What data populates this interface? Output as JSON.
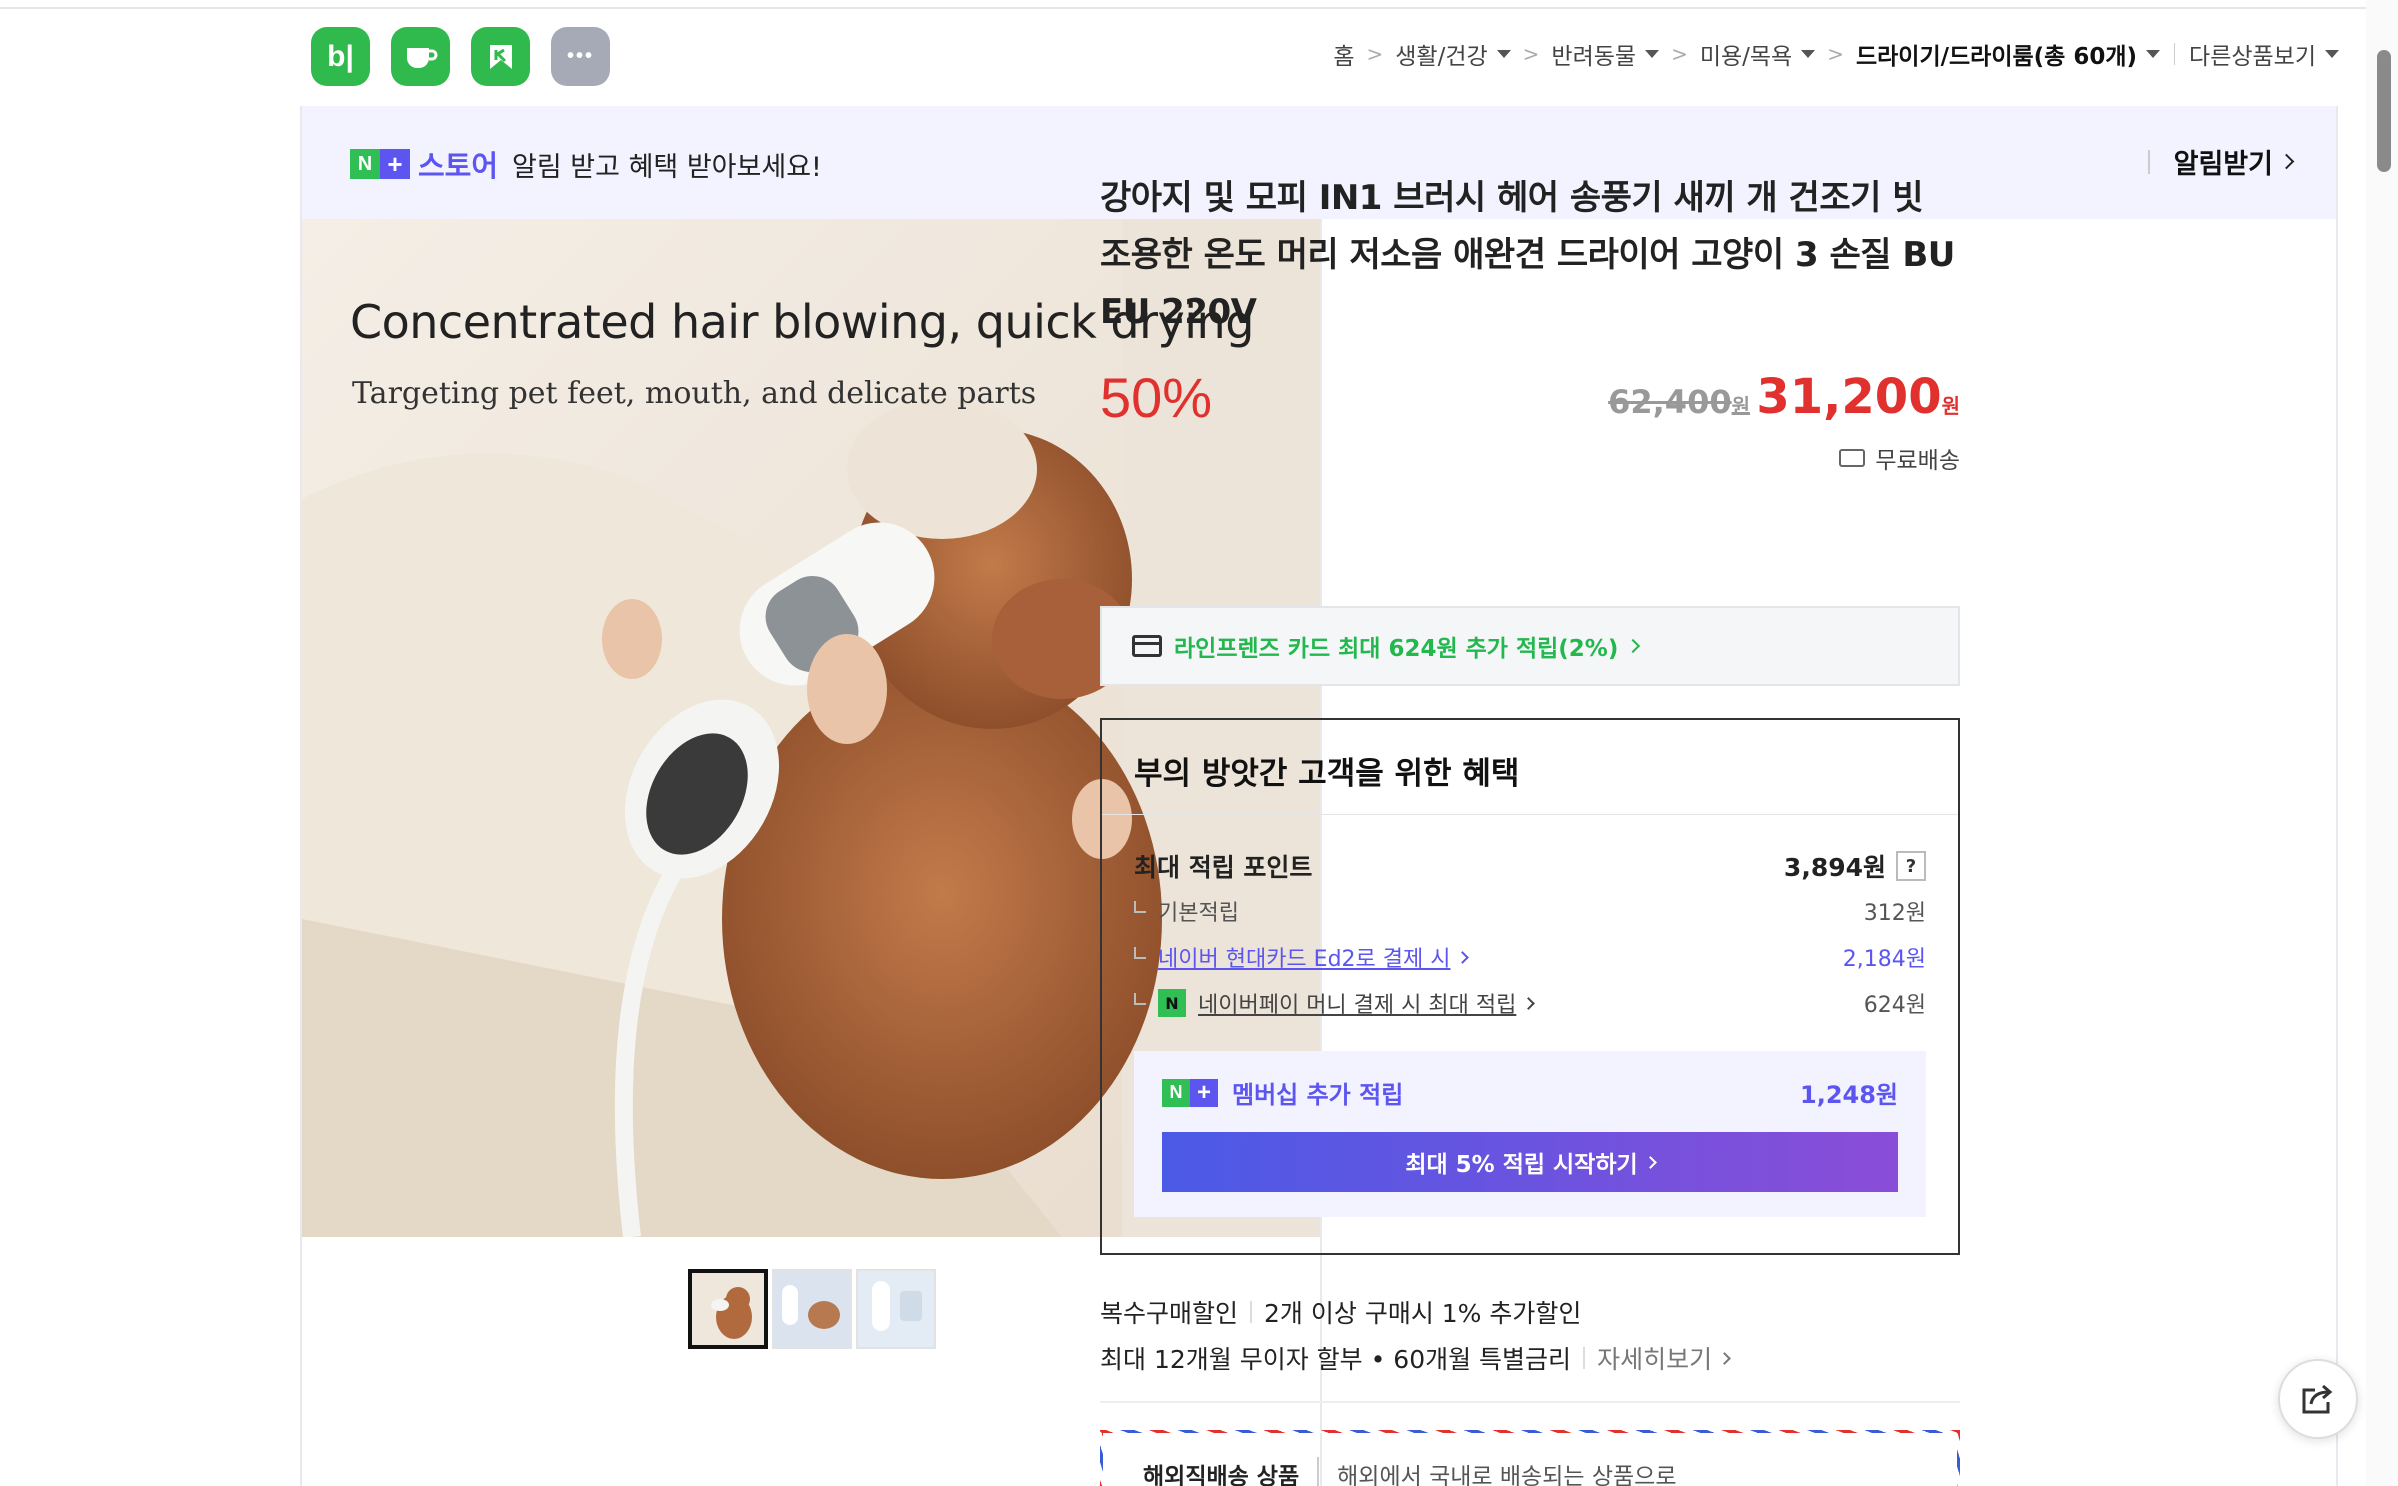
{
  "app_icons": [
    {
      "name": "blog-icon",
      "glyph": "b|",
      "color": "#30b94c"
    },
    {
      "name": "cafe-icon",
      "glyph": "☕",
      "color": "#30b94c"
    },
    {
      "name": "kin-icon",
      "glyph": "K",
      "color": "#30b94c"
    },
    {
      "name": "more-icon",
      "glyph": "•••",
      "color": "#a5aab6"
    }
  ],
  "breadcrumb": {
    "home": "홈",
    "cat1": "생활/건강",
    "cat2": "반려동물",
    "cat3": "미용/목욕",
    "cat4": "드라이기/드라이룸(총 60개)",
    "other": "다른상품보기"
  },
  "banner": {
    "store": "스토어",
    "message": "알림 받고 혜택 받아보세요!",
    "action": "알림받기"
  },
  "product_image": {
    "headline": "Concentrated hair blowing, quick drying",
    "subline": "Targeting pet feet, mouth, and delicate parts"
  },
  "product": {
    "title": "강아지 및 모피 IN1 브러시 헤어 송풍기 새끼 개 건조기 빗 조용한 온도 머리 저소음 애완견 드라이어 고양이 3 손질 BU EU 220V",
    "discount": "50%",
    "original_price": "62,400",
    "sale_price": "31,200",
    "currency": "원",
    "shipping": "무료배송"
  },
  "card_promo": "라인프렌즈 카드 최대 624원 추가 적립(2%)",
  "benefits": {
    "title": "부의 방앗간 고객을 위한 혜택",
    "max_points_label": "최대 적립 포인트",
    "max_points_value": "3,894원",
    "help": "?",
    "basic_label": "기본적립",
    "basic_value": "312원",
    "card_label": "네이버 현대카드 Ed2로 결제 시",
    "card_value": "2,184원",
    "npay_label": "네이버페이 머니 결제 시 최대 적립",
    "npay_value": "624원",
    "membership_label": "멤버십 추가 적립",
    "membership_value": "1,248원",
    "membership_button": "최대 5% 적립 시작하기"
  },
  "extras": {
    "multi_label": "복수구매할인",
    "multi_value": "2개 이상 구매시 1% 추가할인",
    "installment": "최대 12개월 무이자 할부 • 60개월 특별금리",
    "details": "자세히보기"
  },
  "overseas": {
    "label": "해외직배송 상품",
    "desc": "해외에서 국내로 배송되는 상품으로"
  }
}
